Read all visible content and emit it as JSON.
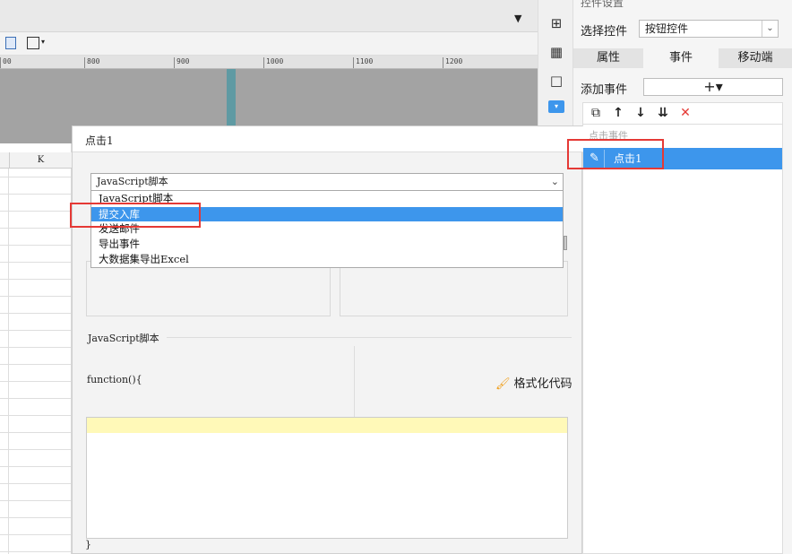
{
  "ruler": {
    "ticks": [
      "800",
      "900",
      "1000",
      "1100",
      "1200"
    ]
  },
  "sheet": {
    "column_label": "K"
  },
  "right_panel": {
    "title": "控件设置",
    "select_label": "选择控件",
    "select_value": "按钮控件",
    "tabs": [
      "属性",
      "事件",
      "移动端"
    ],
    "active_tab": "事件",
    "add_event_label": "添加事件",
    "add_button": "+▾",
    "event_list_header": "点击事件",
    "events": [
      {
        "name": "点击1",
        "selected": true
      }
    ]
  },
  "dialog": {
    "title": "点击1",
    "type_combo_value": "JavaScript脚本",
    "options": [
      "JavaScript脚本",
      "提交入库",
      "发送邮件",
      "导出事件",
      "大数据集导出Excel"
    ],
    "highlighted_option": "提交入库",
    "js_section_label": "JavaScript脚本",
    "function_header": "function(){",
    "format_button": "格式化代码",
    "closing_brace": "}"
  },
  "colors": {
    "accent": "#3d96ec",
    "annotation_red": "#e53935",
    "code_highlight": "#fff9b8"
  }
}
